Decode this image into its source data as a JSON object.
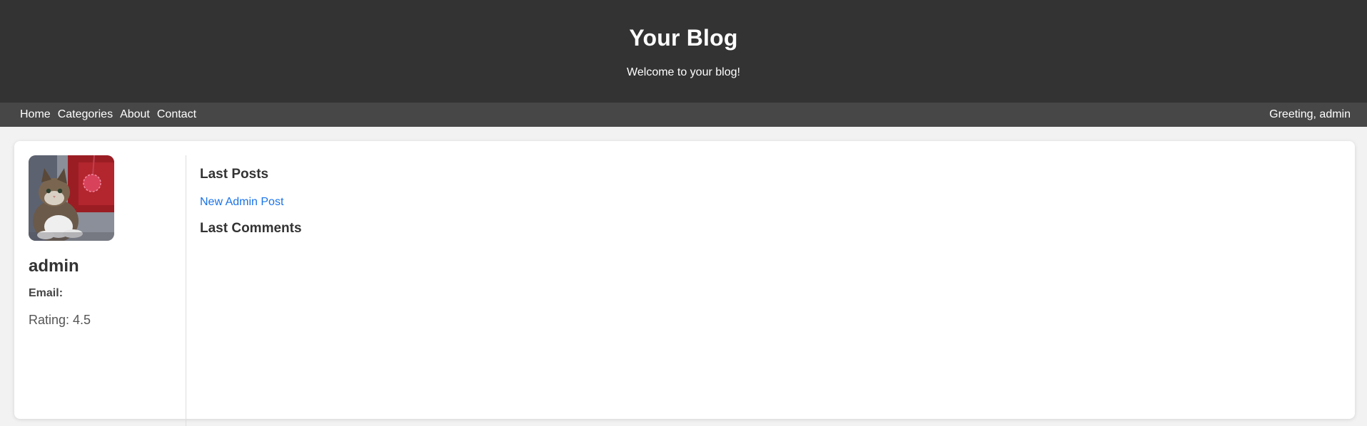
{
  "header": {
    "title": "Your Blog",
    "subtitle": "Welcome to your blog!"
  },
  "nav": {
    "items": [
      {
        "label": "Home"
      },
      {
        "label": "Categories"
      },
      {
        "label": "About"
      },
      {
        "label": "Contact"
      }
    ],
    "greeting": "Greeting, admin"
  },
  "profile": {
    "avatar_icon": "cat-photo-avatar",
    "username": "admin",
    "email_label": "Email:",
    "email_value": "",
    "rating": "Rating: 4.5"
  },
  "content": {
    "last_posts_heading": "Last Posts",
    "posts": [
      {
        "title": "New Admin Post"
      }
    ],
    "last_comments_heading": "Last Comments"
  },
  "colors": {
    "header_bg": "#333333",
    "nav_bg": "#474747",
    "link": "#1a73e8"
  }
}
